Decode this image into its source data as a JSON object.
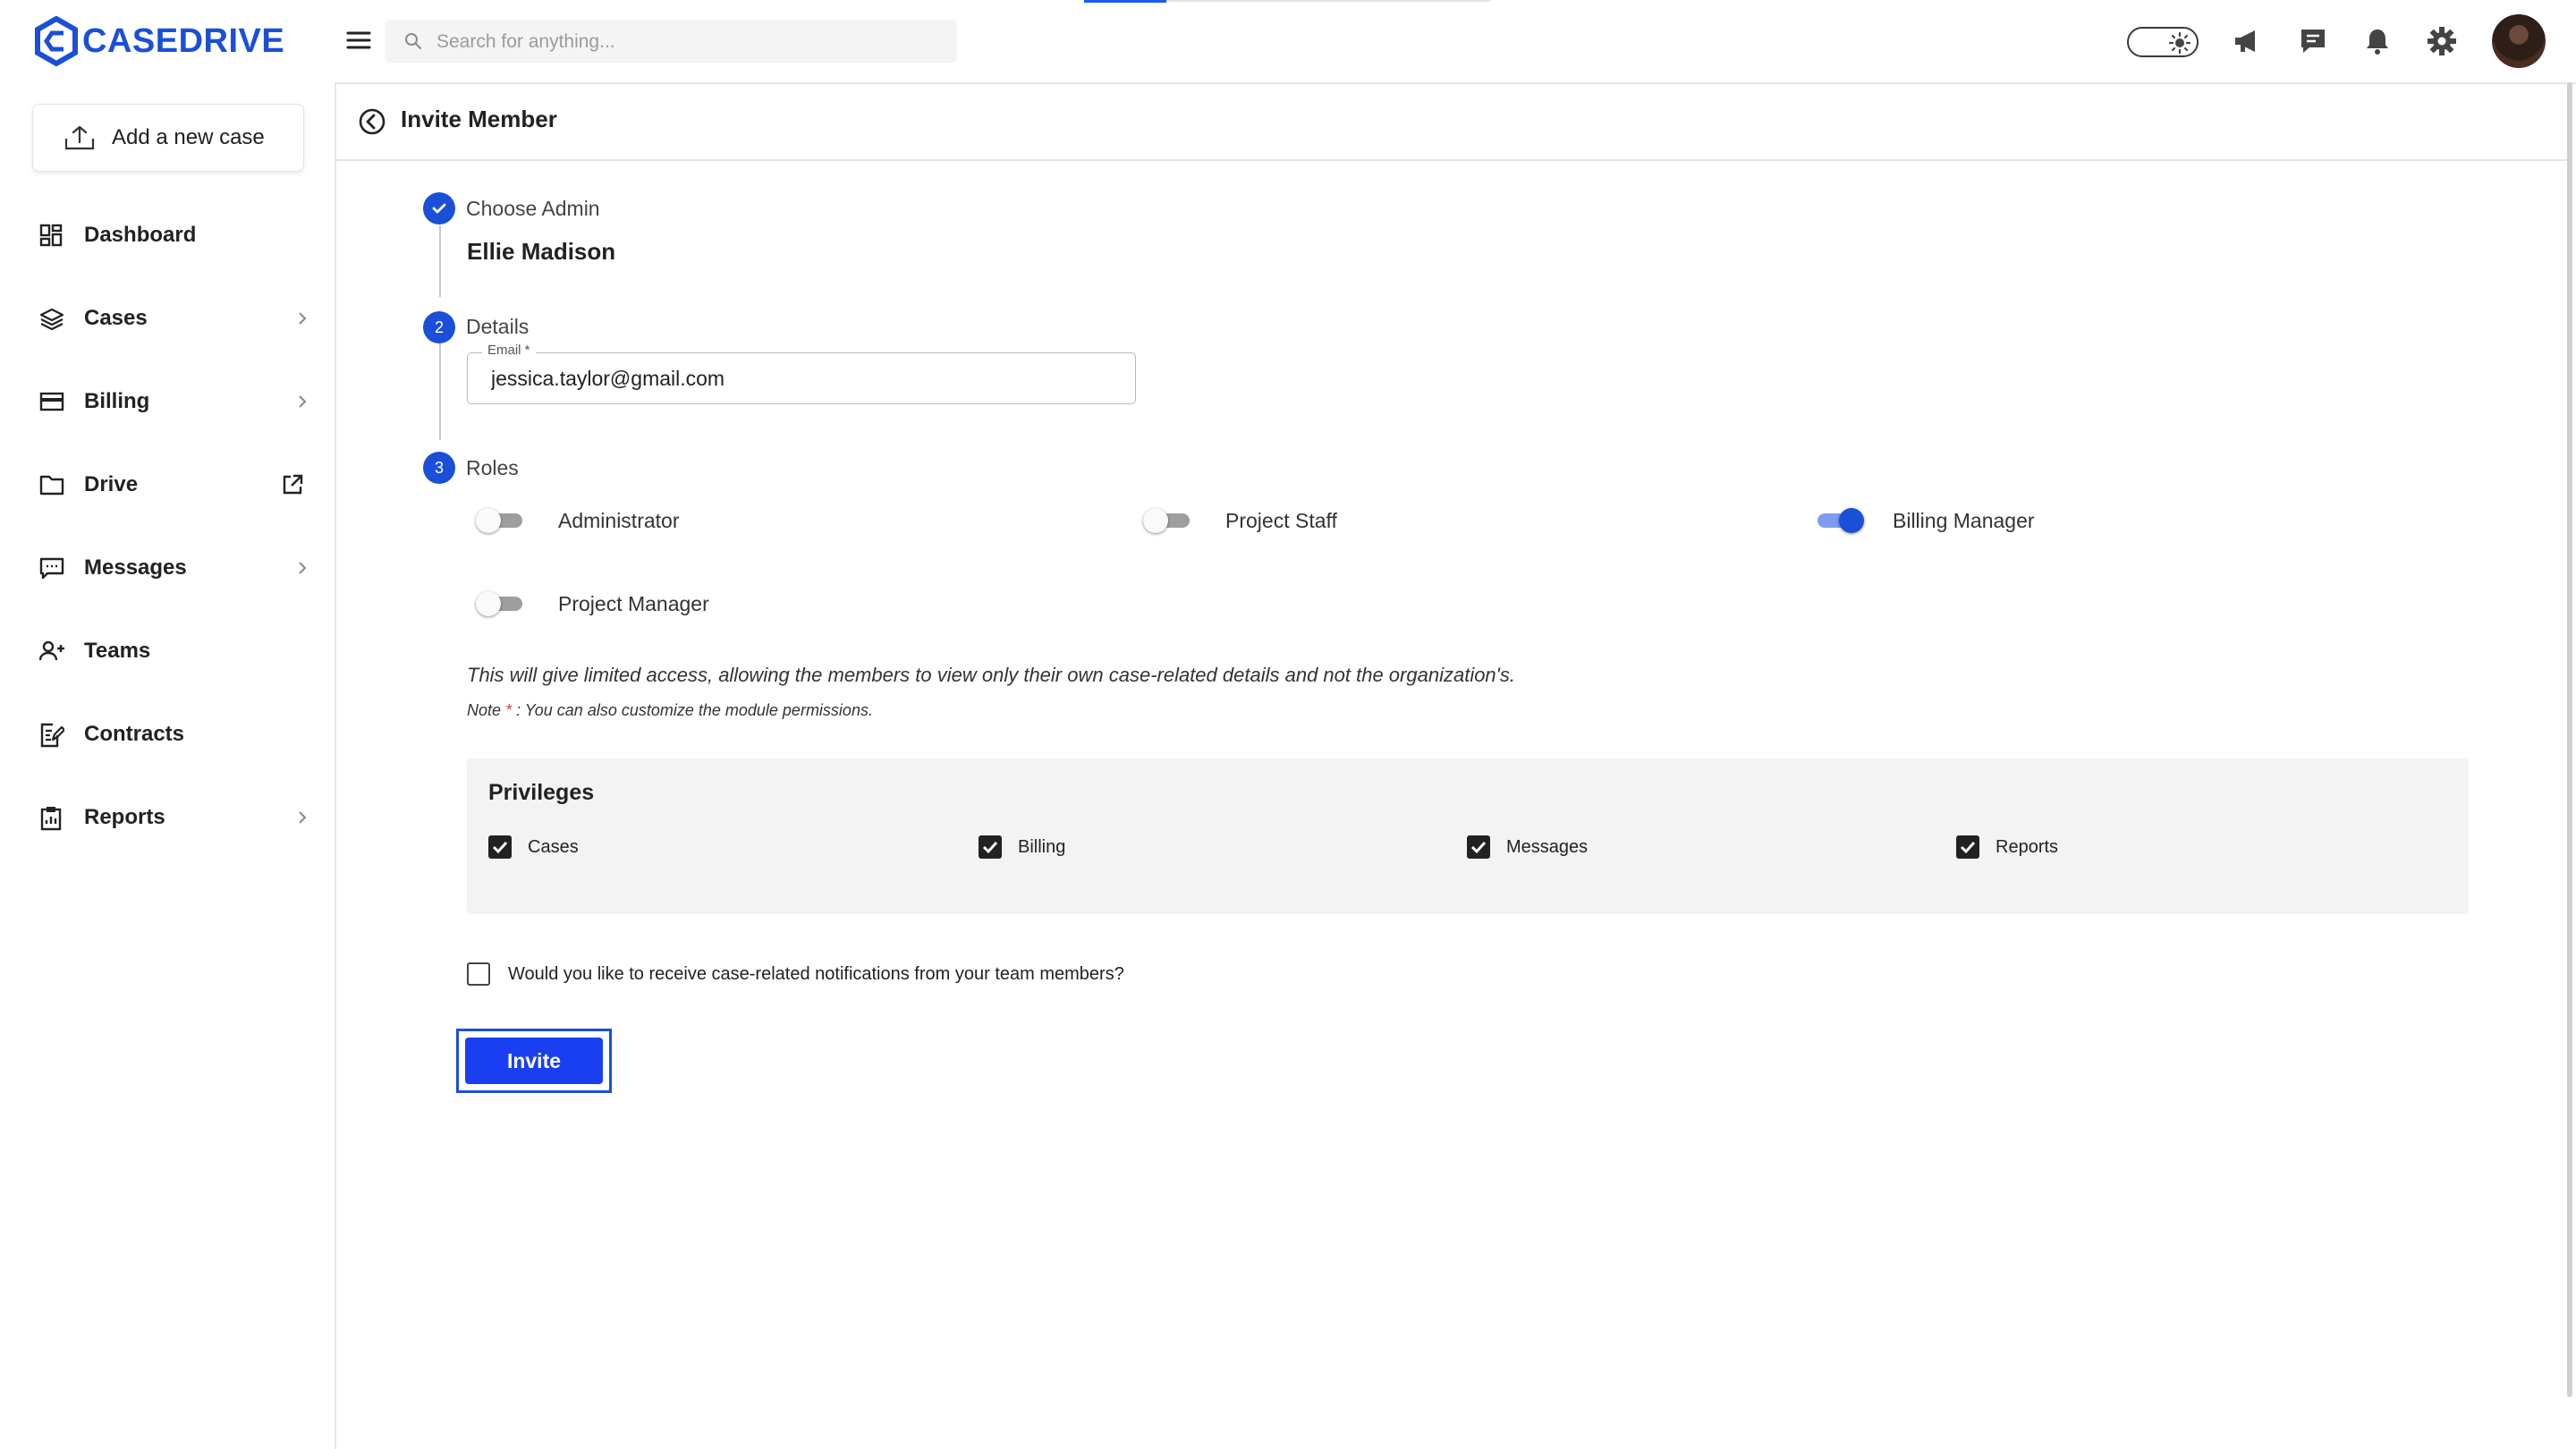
{
  "brand": {
    "name": "CASEDRIVE",
    "color": "#1a4fd8"
  },
  "search": {
    "placeholder": "Search for anything..."
  },
  "topbar_icons": [
    "theme-toggle-icon",
    "megaphone-icon",
    "chat-icon",
    "bell-icon",
    "gear-icon",
    "avatar"
  ],
  "sidebar": {
    "add_case_label": "Add a new case",
    "items": [
      {
        "label": "Dashboard",
        "icon": "dashboard-icon"
      },
      {
        "label": "Cases",
        "icon": "layers-icon",
        "has_submenu": true
      },
      {
        "label": "Billing",
        "icon": "credit-card-icon",
        "has_submenu": true
      },
      {
        "label": "Drive",
        "icon": "folder-icon",
        "external_link": true
      },
      {
        "label": "Messages",
        "icon": "message-icon",
        "has_submenu": true
      },
      {
        "label": "Teams",
        "icon": "team-icon"
      },
      {
        "label": "Contracts",
        "icon": "contract-icon"
      },
      {
        "label": "Reports",
        "icon": "clipboard-icon",
        "has_submenu": true
      }
    ]
  },
  "page": {
    "title": "Invite Member"
  },
  "steps": [
    {
      "number": "",
      "label": "Choose Admin",
      "completed": true,
      "value": "Ellie Madison"
    },
    {
      "number": "2",
      "label": "Details"
    },
    {
      "number": "3",
      "label": "Roles"
    }
  ],
  "email": {
    "legend": "Email *",
    "value": "jessica.taylor@gmail.com"
  },
  "roles": [
    {
      "label": "Administrator",
      "enabled": false
    },
    {
      "label": "Project Staff",
      "enabled": false
    },
    {
      "label": "Billing Manager",
      "enabled": true
    },
    {
      "label": "Project Manager",
      "enabled": false
    }
  ],
  "notes": {
    "description": "This will give limited access, allowing the members to view only their own case-related details and not the organization's.",
    "note_prefix": "Note",
    "note_star": "*",
    "note_text": ": You can also customize the module permissions."
  },
  "privileges": {
    "title": "Privileges",
    "items": [
      {
        "label": "Cases",
        "checked": true
      },
      {
        "label": "Billing",
        "checked": true
      },
      {
        "label": "Messages",
        "checked": true
      },
      {
        "label": "Reports",
        "checked": true
      }
    ]
  },
  "notification_question": {
    "label": "Would you like to receive case-related notifications from your team members?",
    "checked": false
  },
  "invite_button": {
    "label": "Invite",
    "color": "#1a3ff0"
  }
}
